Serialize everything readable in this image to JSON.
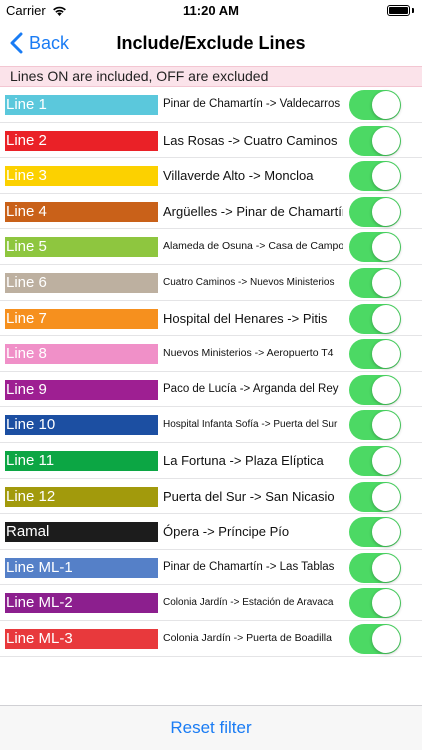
{
  "status_bar": {
    "carrier": "Carrier",
    "time": "11:20 AM"
  },
  "nav": {
    "back_label": "Back",
    "title": "Include/Exclude Lines"
  },
  "banner": "Lines ON are included, OFF are excluded",
  "lines": [
    {
      "label": "Line 1",
      "color": "#5bc8dc",
      "route": "Pinar de Chamartín -> Valdecarros",
      "font_size": 11.5,
      "on": true
    },
    {
      "label": "Line 2",
      "color": "#ea2127",
      "route": "Las Rosas -> Cuatro Caminos",
      "font_size": 13,
      "on": true
    },
    {
      "label": "Line 3",
      "color": "#fcd100",
      "route": "Villaverde Alto -> Moncloa",
      "font_size": 13,
      "on": true
    },
    {
      "label": "Line 4",
      "color": "#c96119",
      "route": "Argüelles -> Pinar de Chamartín",
      "font_size": 13,
      "on": true
    },
    {
      "label": "Line 5",
      "color": "#8ec63f",
      "route": "Alameda de Osuna -> Casa de Campo",
      "font_size": 10.5,
      "on": true
    },
    {
      "label": "Line 6",
      "color": "#bdb0a0",
      "route": "Cuatro Caminos -> Nuevos Ministerios",
      "font_size": 10,
      "on": true
    },
    {
      "label": "Line 7",
      "color": "#f6901e",
      "route": "Hospital del Henares -> Pitis",
      "font_size": 13,
      "on": true
    },
    {
      "label": "Line 8",
      "color": "#f090c8",
      "route": "Nuevos Ministerios -> Aeropuerto T4",
      "font_size": 10.5,
      "on": true
    },
    {
      "label": "Line 9",
      "color": "#9e1f92",
      "route": "Paco de Lucía -> Arganda del Rey",
      "font_size": 11.5,
      "on": true
    },
    {
      "label": "Line 10",
      "color": "#1c4fa2",
      "route": "Hospital Infanta Sofía -> Puerta del Sur",
      "font_size": 10,
      "on": true
    },
    {
      "label": "Line 11",
      "color": "#0ca644",
      "route": "La Fortuna -> Plaza Elíptica",
      "font_size": 13,
      "on": true
    },
    {
      "label": "Line 12",
      "color": "#a29a0c",
      "route": "Puerta del Sur -> San Nicasio",
      "font_size": 13,
      "on": true
    },
    {
      "label": "Ramal",
      "color": "#1c1c1c",
      "route": "Ópera -> Príncipe Pío",
      "font_size": 13,
      "on": true
    },
    {
      "label": "Line ML-1",
      "color": "#5580c8",
      "route": "Pinar de Chamartín -> Las Tablas",
      "font_size": 11.5,
      "on": true
    },
    {
      "label": "Line ML-2",
      "color": "#8c1f8e",
      "route": "Colonia Jardín -> Estación de Aravaca",
      "font_size": 10,
      "on": true
    },
    {
      "label": "Line ML-3",
      "color": "#e8393c",
      "route": "Colonia Jardín -> Puerta de Boadilla",
      "font_size": 10.5,
      "on": true
    }
  ],
  "footer": {
    "reset_label": "Reset filter"
  },
  "colors": {
    "accent": "#1a7cf4",
    "switch_on": "#4cd964",
    "banner_bg": "#fbe3ea"
  }
}
